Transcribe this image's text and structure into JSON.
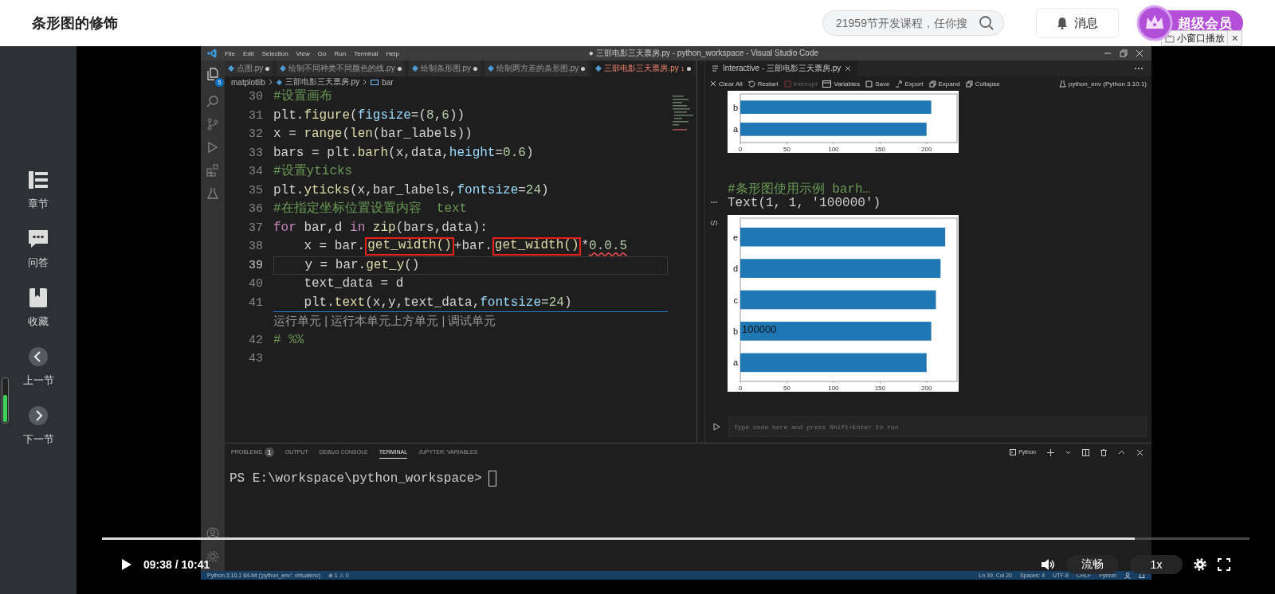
{
  "page_title": "条形图的修饰",
  "search": {
    "placeholder": "21959节开发课程，任你搜"
  },
  "messages_button": "消息",
  "vip_badge": "超级会员",
  "mini_player_tip": {
    "label": "小窗口播放",
    "close": "×"
  },
  "sidebar": {
    "items": [
      {
        "label": "章节",
        "kind": "chapters"
      },
      {
        "label": "问答",
        "kind": "qa"
      },
      {
        "label": "收藏",
        "kind": "favorites"
      },
      {
        "label": "上一节",
        "kind": "prev"
      },
      {
        "label": "下一节",
        "kind": "next"
      }
    ]
  },
  "vscode": {
    "menu": [
      "File",
      "Edit",
      "Selection",
      "View",
      "Go",
      "Run",
      "Terminal",
      "Help"
    ],
    "title": "● 三部电影三天票房.py - python_workspace - Visual Studio Code",
    "explorer_badge": "5",
    "tabs": [
      {
        "label": "点图.py",
        "selected": false,
        "modified": true
      },
      {
        "label": "绘制不同种类不同颜色的线.py",
        "selected": false,
        "modified": true
      },
      {
        "label": "绘制条形图.py",
        "selected": false,
        "modified": true
      },
      {
        "label": "绘制两方差的条形图.py",
        "selected": false,
        "modified": true
      },
      {
        "label": "三部电影三天票房.py",
        "selected": true,
        "modified": true,
        "problems": "1"
      }
    ],
    "breadcrumbs": [
      "matplotlib",
      "三部电影三天票房.py",
      "bar"
    ],
    "code_lines": [
      {
        "kind": "code",
        "num": "30",
        "current": false,
        "tokens": [
          {
            "t": "#设置画布",
            "kind": "comment"
          }
        ]
      },
      {
        "kind": "code",
        "num": "31",
        "current": false,
        "tokens": [
          {
            "t": "plt.",
            "kind": "plain"
          },
          {
            "t": "figure",
            "kind": "fn"
          },
          {
            "t": "(",
            "kind": "plain"
          },
          {
            "t": "figsize",
            "kind": "param"
          },
          {
            "t": "=(",
            "kind": "plain"
          },
          {
            "t": "8",
            "kind": "num"
          },
          {
            "t": ",",
            "kind": "plain"
          },
          {
            "t": "6",
            "kind": "num"
          },
          {
            "t": "))",
            "kind": "plain"
          }
        ]
      },
      {
        "kind": "code",
        "num": "32",
        "current": false,
        "tokens": [
          {
            "t": "x = ",
            "kind": "plain"
          },
          {
            "t": "range",
            "kind": "fn"
          },
          {
            "t": "(",
            "kind": "plain"
          },
          {
            "t": "len",
            "kind": "fn"
          },
          {
            "t": "(bar_labels))",
            "kind": "plain"
          }
        ]
      },
      {
        "kind": "code",
        "num": "33",
        "current": false,
        "tokens": [
          {
            "t": "bars = plt.",
            "kind": "plain"
          },
          {
            "t": "barh",
            "kind": "fn"
          },
          {
            "t": "(x,data,",
            "kind": "plain"
          },
          {
            "t": "height",
            "kind": "param"
          },
          {
            "t": "=",
            "kind": "plain"
          },
          {
            "t": "0.6",
            "kind": "num"
          },
          {
            "t": ")",
            "kind": "plain"
          }
        ]
      },
      {
        "kind": "code",
        "num": "34",
        "current": false,
        "tokens": [
          {
            "t": "#设置yticks",
            "kind": "comment"
          }
        ]
      },
      {
        "kind": "code",
        "num": "35",
        "current": false,
        "tokens": [
          {
            "t": "plt.",
            "kind": "plain"
          },
          {
            "t": "yticks",
            "kind": "fn"
          },
          {
            "t": "(x,bar_labels,",
            "kind": "plain"
          },
          {
            "t": "fontsize",
            "kind": "param"
          },
          {
            "t": "=",
            "kind": "plain"
          },
          {
            "t": "24",
            "kind": "num"
          },
          {
            "t": ")",
            "kind": "plain"
          }
        ]
      },
      {
        "kind": "code",
        "num": "36",
        "current": false,
        "tokens": [
          {
            "t": "#在指定坐标位置设置内容  text",
            "kind": "comment"
          }
        ]
      },
      {
        "kind": "code",
        "num": "37",
        "current": false,
        "tokens": [
          {
            "t": "for",
            "kind": "kw"
          },
          {
            "t": " bar,d ",
            "kind": "plain"
          },
          {
            "t": "in",
            "kind": "kw"
          },
          {
            "t": " zip",
            "kind": "fn"
          },
          {
            "t": "(bars,data):",
            "kind": "plain"
          }
        ]
      },
      {
        "kind": "code",
        "num": "38",
        "current": false,
        "tokens": [
          {
            "t": "    x = bar.",
            "kind": "plain"
          },
          {
            "t": "get_width()",
            "kind": "fn",
            "boxed": true
          },
          {
            "t": "+bar.",
            "kind": "plain"
          },
          {
            "t": "get_width()",
            "kind": "fn",
            "boxed": true
          },
          {
            "t": "*",
            "kind": "plain"
          },
          {
            "t": "0.0.5",
            "kind": "num",
            "squiggle": true
          }
        ]
      },
      {
        "kind": "code",
        "num": "39",
        "current": true,
        "tokens": [
          {
            "t": "    y = bar.",
            "kind": "plain"
          },
          {
            "t": "get_y",
            "kind": "fn"
          },
          {
            "t": "()",
            "kind": "plain"
          }
        ]
      },
      {
        "kind": "code",
        "num": "40",
        "current": false,
        "tokens": [
          {
            "t": "    text_data = d",
            "kind": "plain"
          }
        ]
      },
      {
        "kind": "code",
        "num": "41",
        "current": false,
        "tokens": [
          {
            "t": "    plt.",
            "kind": "plain"
          },
          {
            "t": "text",
            "kind": "fn"
          },
          {
            "t": "(x,y,text_data,",
            "kind": "plain"
          },
          {
            "t": "fontsize",
            "kind": "param"
          },
          {
            "t": "=",
            "kind": "plain"
          },
          {
            "t": "24",
            "kind": "num"
          },
          {
            "t": ")",
            "kind": "plain"
          }
        ]
      },
      {
        "kind": "codelens",
        "text": "运行单元 | 运行本单元上方单元 | 调试单元"
      },
      {
        "kind": "code",
        "num": "42",
        "current": false,
        "tokens": [
          {
            "t": "# %%",
            "kind": "comment"
          }
        ]
      },
      {
        "kind": "code",
        "num": "43",
        "current": false
      }
    ],
    "interactive": {
      "tab": "Interactive - 三部电影三天票房.py",
      "toolbar": [
        {
          "label": "Clear All",
          "kind": "clear",
          "disabled": false
        },
        {
          "label": "Restart",
          "kind": "restart",
          "disabled": false
        },
        {
          "label": "Interrupt",
          "kind": "interrupt",
          "disabled": true
        },
        {
          "label": "Variables",
          "kind": "variables",
          "disabled": false
        },
        {
          "label": "Save",
          "kind": "save",
          "disabled": false
        },
        {
          "label": "Export",
          "kind": "export",
          "disabled": false
        },
        {
          "label": "Expand",
          "kind": "expand",
          "disabled": false
        },
        {
          "label": "Collapse",
          "kind": "collapse",
          "disabled": false
        }
      ],
      "kernel": "python_env (Python 3.10.1)",
      "cells": [
        {
          "kind": "chart",
          "chart_data": {
            "type": "bar",
            "orientation": "horizontal",
            "categories": [
              "b",
              "a"
            ],
            "values": [
              205,
              200
            ],
            "xlim": [
              0,
              231
            ],
            "xticks": [
              0,
              50,
              100,
              150,
              200
            ]
          }
        },
        {
          "kind": "code",
          "text": "#条形图使用示例 barh…"
        },
        {
          "kind": "output",
          "text": "Text(1, 1, '100000')"
        },
        {
          "kind": "chart",
          "chart_data": {
            "type": "bar",
            "orientation": "horizontal",
            "categories": [
              "e",
              "d",
              "c",
              "b",
              "a"
            ],
            "values": [
              220,
              215,
              210,
              205,
              200
            ],
            "xlim": [
              0,
              231
            ],
            "xticks": [
              0,
              50,
              100,
              150,
              200
            ],
            "annotations": [
              {
                "text": "100000",
                "y": "b"
              }
            ]
          }
        }
      ],
      "input_placeholder": "Type code here and press Shift+Enter to run"
    },
    "panel": {
      "tabs": [
        {
          "label": "PROBLEMS",
          "selected": false,
          "badge": "1"
        },
        {
          "label": "OUTPUT",
          "selected": false
        },
        {
          "label": "DEBUG CONSOLE",
          "selected": false
        },
        {
          "label": "TERMINAL",
          "selected": true
        },
        {
          "label": "JUPYTER: VARIABLES",
          "selected": false
        }
      ],
      "terminal_profile": "Python",
      "prompt": "PS E:\\workspace\\python_workspace>"
    },
    "status_bar": {
      "left": [
        "Python 3.10.1 64-bit ('python_env': virtualenv)",
        "⊗ 1 ⚠ 0"
      ],
      "right": [
        "Ln 39, Col 20",
        "Spaces: 4",
        "UTF-8",
        "CRLF",
        "Python"
      ]
    }
  },
  "player": {
    "progress": {
      "level": 0.9
    },
    "time": "09:38 / 10:41",
    "quality": "流畅",
    "speed": "1x"
  }
}
